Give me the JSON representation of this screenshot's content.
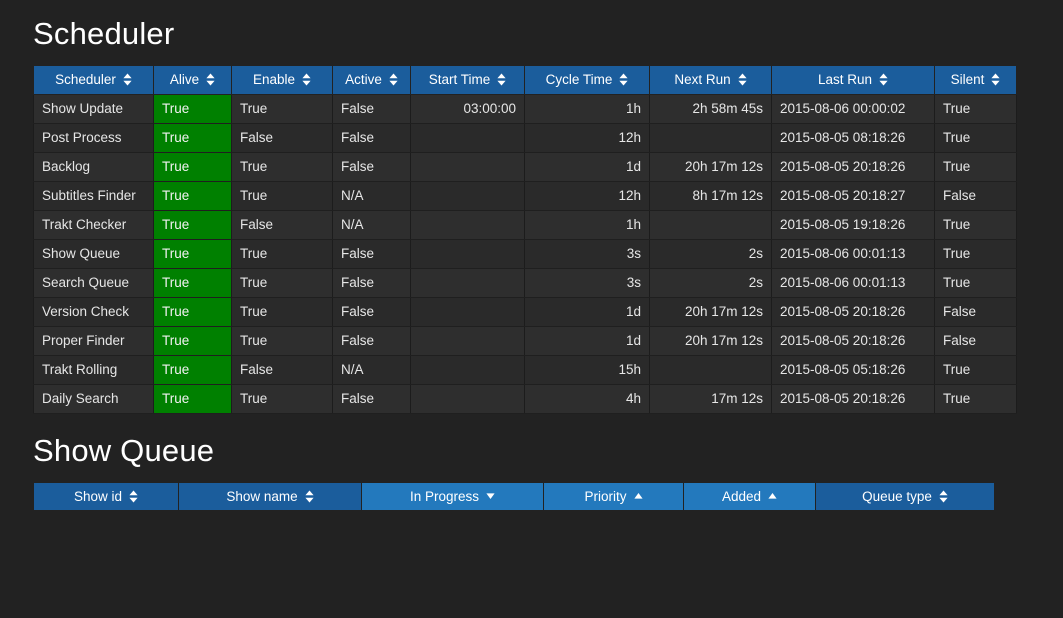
{
  "scheduler": {
    "title": "Scheduler",
    "columns": [
      {
        "label": "Scheduler",
        "sort": "none",
        "align": "left"
      },
      {
        "label": "Alive",
        "sort": "none",
        "align": "left"
      },
      {
        "label": "Enable",
        "sort": "none",
        "align": "left"
      },
      {
        "label": "Active",
        "sort": "none",
        "align": "left"
      },
      {
        "label": "Start Time",
        "sort": "none",
        "align": "right"
      },
      {
        "label": "Cycle Time",
        "sort": "none",
        "align": "right"
      },
      {
        "label": "Next Run",
        "sort": "none",
        "align": "right"
      },
      {
        "label": "Last Run",
        "sort": "none",
        "align": "left"
      },
      {
        "label": "Silent",
        "sort": "none",
        "align": "left"
      }
    ],
    "rows": [
      {
        "scheduler": "Show Update",
        "alive": "True",
        "enable": "True",
        "active": "False",
        "start_time": "03:00:00",
        "cycle_time": "1h",
        "next_run": "2h 58m 45s",
        "last_run": "2015-08-06 00:00:02",
        "silent": "True"
      },
      {
        "scheduler": "Post Process",
        "alive": "True",
        "enable": "False",
        "active": "False",
        "start_time": "",
        "cycle_time": "12h",
        "next_run": "",
        "last_run": "2015-08-05 08:18:26",
        "silent": "True"
      },
      {
        "scheduler": "Backlog",
        "alive": "True",
        "enable": "True",
        "active": "False",
        "start_time": "",
        "cycle_time": "1d",
        "next_run": "20h 17m 12s",
        "last_run": "2015-08-05 20:18:26",
        "silent": "True"
      },
      {
        "scheduler": "Subtitles Finder",
        "alive": "True",
        "enable": "True",
        "active": "N/A",
        "start_time": "",
        "cycle_time": "12h",
        "next_run": "8h 17m 12s",
        "last_run": "2015-08-05 20:18:27",
        "silent": "False"
      },
      {
        "scheduler": "Trakt Checker",
        "alive": "True",
        "enable": "False",
        "active": "N/A",
        "start_time": "",
        "cycle_time": "1h",
        "next_run": "",
        "last_run": "2015-08-05 19:18:26",
        "silent": "True"
      },
      {
        "scheduler": "Show Queue",
        "alive": "True",
        "enable": "True",
        "active": "False",
        "start_time": "",
        "cycle_time": "3s",
        "next_run": "2s",
        "last_run": "2015-08-06 00:01:13",
        "silent": "True"
      },
      {
        "scheduler": "Search Queue",
        "alive": "True",
        "enable": "True",
        "active": "False",
        "start_time": "",
        "cycle_time": "3s",
        "next_run": "2s",
        "last_run": "2015-08-06 00:01:13",
        "silent": "True"
      },
      {
        "scheduler": "Version Check",
        "alive": "True",
        "enable": "True",
        "active": "False",
        "start_time": "",
        "cycle_time": "1d",
        "next_run": "20h 17m 12s",
        "last_run": "2015-08-05 20:18:26",
        "silent": "False"
      },
      {
        "scheduler": "Proper Finder",
        "alive": "True",
        "enable": "True",
        "active": "False",
        "start_time": "",
        "cycle_time": "1d",
        "next_run": "20h 17m 12s",
        "last_run": "2015-08-05 20:18:26",
        "silent": "False"
      },
      {
        "scheduler": "Trakt Rolling",
        "alive": "True",
        "enable": "False",
        "active": "N/A",
        "start_time": "",
        "cycle_time": "15h",
        "next_run": "",
        "last_run": "2015-08-05 05:18:26",
        "silent": "True"
      },
      {
        "scheduler": "Daily Search",
        "alive": "True",
        "enable": "True",
        "active": "False",
        "start_time": "",
        "cycle_time": "4h",
        "next_run": "17m 12s",
        "last_run": "2015-08-05 20:18:26",
        "silent": "True"
      }
    ]
  },
  "show_queue": {
    "title": "Show Queue",
    "columns": [
      {
        "label": "Show id",
        "sort": "none",
        "highlighted": false
      },
      {
        "label": "Show name",
        "sort": "none",
        "highlighted": false
      },
      {
        "label": "In Progress",
        "sort": "descending",
        "highlighted": true
      },
      {
        "label": "Priority",
        "sort": "ascending",
        "highlighted": true
      },
      {
        "label": "Added",
        "sort": "ascending",
        "highlighted": true
      },
      {
        "label": "Queue type",
        "sort": "none",
        "highlighted": false
      }
    ],
    "rows": []
  },
  "colors": {
    "page_background": "#222222",
    "header_blue": "#1b5d9c",
    "header_blue_highlight": "#2379bd",
    "alive_green": "#008000",
    "row_odd": "#2e2e2e",
    "row_even": "#2a2a2a",
    "text": "#e6e6e6",
    "title": "#ffffff"
  },
  "icons": {
    "sort_none": "sort-both-icon",
    "sort_ascending": "sort-asc-icon",
    "sort_descending": "sort-desc-icon"
  }
}
